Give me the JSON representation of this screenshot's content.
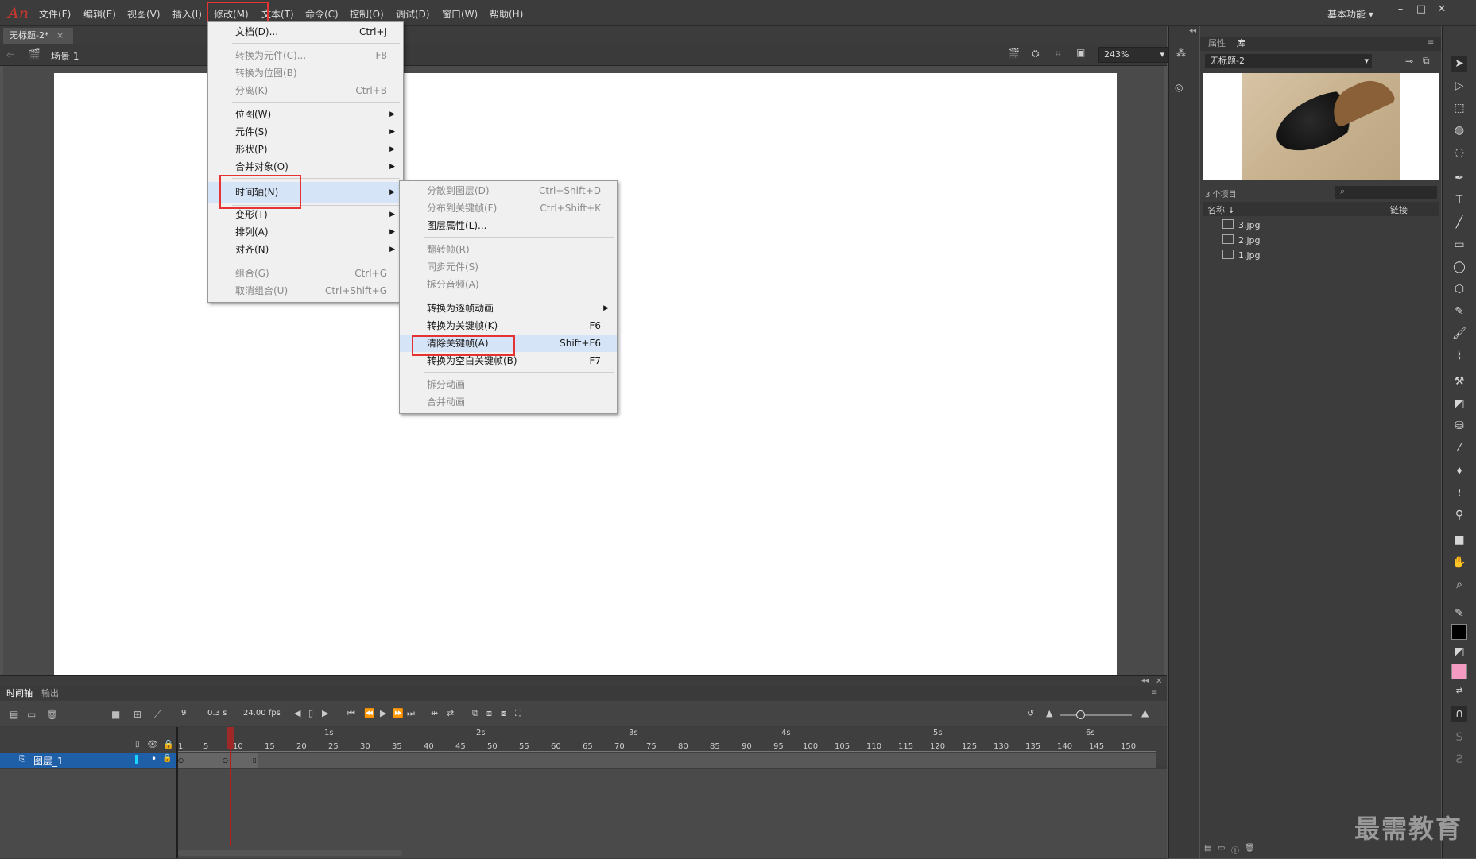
{
  "app_logo": "An",
  "menubar": [
    "文件(F)",
    "编辑(E)",
    "视图(V)",
    "插入(I)",
    "修改(M)",
    "文本(T)",
    "命令(C)",
    "控制(O)",
    "调试(D)",
    "窗口(W)",
    "帮助(H)"
  ],
  "workspace": "基本功能",
  "doc_tab": "无标题-2*",
  "scene": "场景 1",
  "zoom": "243%",
  "modify_menu": [
    {
      "label": "文档(D)...",
      "shortcut": "Ctrl+J",
      "disabled": false
    },
    {
      "label": "转换为元件(C)...",
      "shortcut": "F8",
      "disabled": true
    },
    {
      "label": "转换为位图(B)",
      "shortcut": "",
      "disabled": true
    },
    {
      "label": "分离(K)",
      "shortcut": "Ctrl+B",
      "disabled": true
    },
    {
      "label": "位图(W)",
      "shortcut": "",
      "disabled": false
    },
    {
      "label": "元件(S)",
      "shortcut": "",
      "disabled": false
    },
    {
      "label": "形状(P)",
      "shortcut": "",
      "disabled": false
    },
    {
      "label": "合并对象(O)",
      "shortcut": "",
      "disabled": false
    },
    {
      "label": "时间轴(N)",
      "shortcut": "",
      "disabled": false
    },
    {
      "label": "变形(T)",
      "shortcut": "",
      "disabled": false
    },
    {
      "label": "排列(A)",
      "shortcut": "",
      "disabled": false
    },
    {
      "label": "对齐(N)",
      "shortcut": "",
      "disabled": false
    },
    {
      "label": "组合(G)",
      "shortcut": "Ctrl+G",
      "disabled": true
    },
    {
      "label": "取消组合(U)",
      "shortcut": "Ctrl+Shift+G",
      "disabled": true
    }
  ],
  "timeline_menu": [
    {
      "label": "分散到图层(D)",
      "shortcut": "Ctrl+Shift+D",
      "disabled": true
    },
    {
      "label": "分布到关键帧(F)",
      "shortcut": "Ctrl+Shift+K",
      "disabled": true
    },
    {
      "label": "图层属性(L)...",
      "shortcut": "",
      "disabled": false
    },
    {
      "label": "翻转帧(R)",
      "shortcut": "",
      "disabled": true
    },
    {
      "label": "同步元件(S)",
      "shortcut": "",
      "disabled": true
    },
    {
      "label": "拆分音频(A)",
      "shortcut": "",
      "disabled": true
    },
    {
      "label": "转换为逐帧动画",
      "shortcut": "",
      "disabled": false
    },
    {
      "label": "转换为关键帧(K)",
      "shortcut": "F6",
      "disabled": false
    },
    {
      "label": "清除关键帧(A)",
      "shortcut": "Shift+F6",
      "disabled": false
    },
    {
      "label": "转换为空白关键帧(B)",
      "shortcut": "F7",
      "disabled": false
    },
    {
      "label": "拆分动画",
      "shortcut": "",
      "disabled": true
    },
    {
      "label": "合并动画",
      "shortcut": "",
      "disabled": true
    }
  ],
  "timeline": {
    "tab1": "时间轴",
    "tab2": "输出",
    "frame": "9",
    "time": "0.3 s",
    "fps": "24.00 fps",
    "seconds": [
      "1s",
      "2s",
      "3s",
      "4s",
      "5s",
      "6s"
    ],
    "frames": [
      "1",
      "5",
      "10",
      "15",
      "20",
      "25",
      "30",
      "35",
      "40",
      "45",
      "50",
      "55",
      "60",
      "65",
      "70",
      "75",
      "80",
      "85",
      "90",
      "95",
      "100",
      "105",
      "110",
      "115",
      "120",
      "125",
      "130",
      "135",
      "140",
      "145",
      "150"
    ],
    "layer": "图层_1"
  },
  "library": {
    "tab1": "属性",
    "tab2": "库",
    "doc": "无标题-2",
    "count": "3 个项目",
    "col_name": "名称 ↓",
    "col_link": "链接",
    "items": [
      "3.jpg",
      "2.jpg",
      "1.jpg"
    ]
  },
  "watermark": "最需教育"
}
